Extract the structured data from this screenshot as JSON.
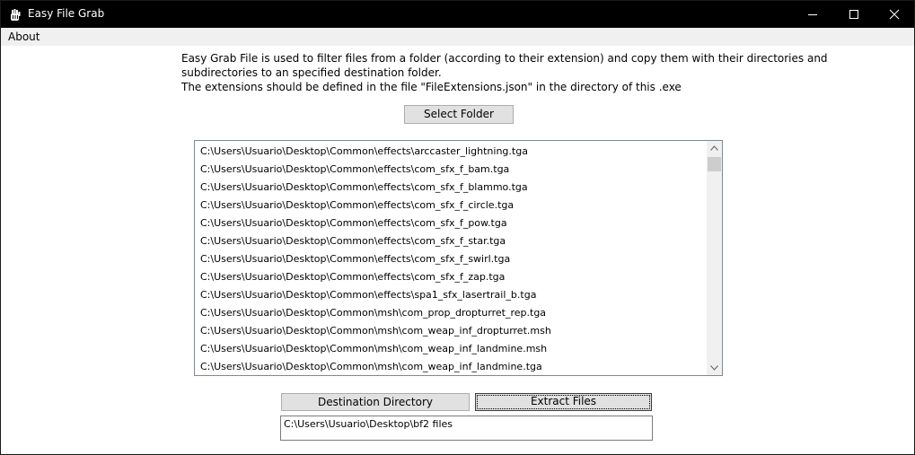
{
  "window": {
    "title": "Easy File Grab"
  },
  "menu": {
    "about": "About"
  },
  "description": {
    "line1": "Easy Grab File is used to filter files from a folder (according to their extension) and copy them with their directories and",
    "line2": "subdirectories to an specified destination folder.",
    "line3": "The extensions should be defined in the file \"FileExtensions.json\" in the directory of this .exe"
  },
  "buttons": {
    "select_folder": "Select Folder",
    "destination_directory": "Destination Directory",
    "extract_files": "Extract Files"
  },
  "files": [
    "C:\\Users\\Usuario\\Desktop\\Common\\effects\\arccaster_lightning.tga",
    "C:\\Users\\Usuario\\Desktop\\Common\\effects\\com_sfx_f_bam.tga",
    "C:\\Users\\Usuario\\Desktop\\Common\\effects\\com_sfx_f_blammo.tga",
    "C:\\Users\\Usuario\\Desktop\\Common\\effects\\com_sfx_f_circle.tga",
    "C:\\Users\\Usuario\\Desktop\\Common\\effects\\com_sfx_f_pow.tga",
    "C:\\Users\\Usuario\\Desktop\\Common\\effects\\com_sfx_f_star.tga",
    "C:\\Users\\Usuario\\Desktop\\Common\\effects\\com_sfx_f_swirl.tga",
    "C:\\Users\\Usuario\\Desktop\\Common\\effects\\com_sfx_f_zap.tga",
    "C:\\Users\\Usuario\\Desktop\\Common\\effects\\spa1_sfx_lasertrail_b.tga",
    "C:\\Users\\Usuario\\Desktop\\Common\\msh\\com_prop_dropturret_rep.tga",
    "C:\\Users\\Usuario\\Desktop\\Common\\msh\\com_weap_inf_dropturret.msh",
    "C:\\Users\\Usuario\\Desktop\\Common\\msh\\com_weap_inf_landmine.msh",
    "C:\\Users\\Usuario\\Desktop\\Common\\msh\\com_weap_inf_landmine.tga"
  ],
  "destination_path": "C:\\Users\\Usuario\\Desktop\\bf2 files",
  "icons": {
    "app": "hand-icon",
    "minimize": "minimize-icon",
    "maximize": "maximize-icon",
    "close": "close-icon",
    "scroll_up": "chevron-up-icon",
    "scroll_down": "chevron-down-icon"
  },
  "colors": {
    "titlebar": "#000000",
    "menubar": "#f0f0f0",
    "button": "#e1e1e1"
  }
}
